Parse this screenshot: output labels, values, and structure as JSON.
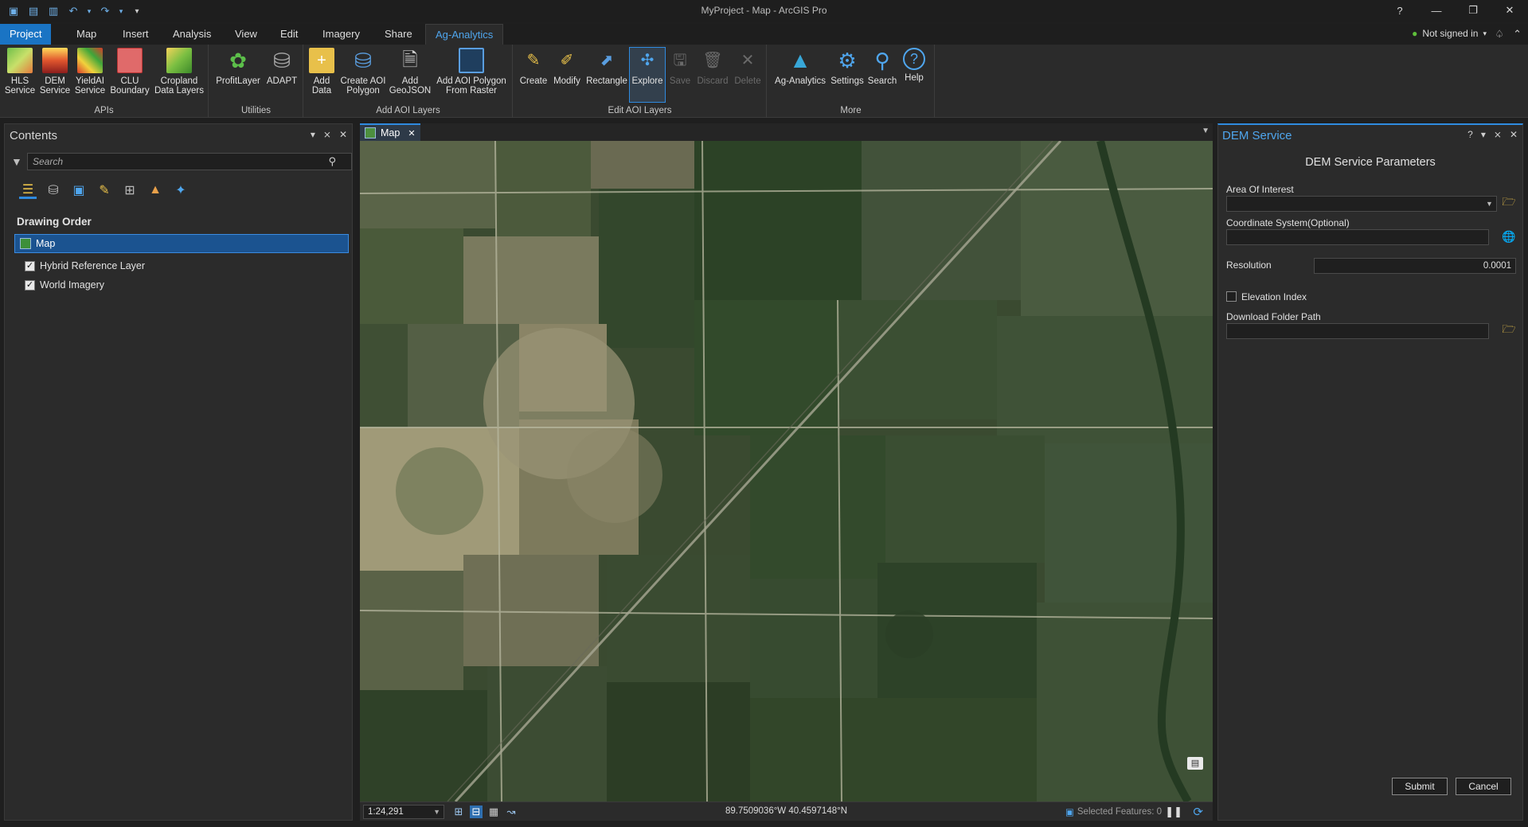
{
  "window": {
    "title": "MyProject - Map - ArcGIS Pro",
    "help": "?",
    "minimize": "—",
    "restore": "❐",
    "close": "✕"
  },
  "qat": {
    "icons": [
      "▣",
      "▤",
      "▥",
      "↶",
      "▾",
      "↷",
      "▾",
      "▾"
    ]
  },
  "tabs": [
    "Project",
    "Map",
    "Insert",
    "Analysis",
    "View",
    "Edit",
    "Imagery",
    "Share",
    "Ag-Analytics"
  ],
  "signin": {
    "label": "Not signed in",
    "arrow": "▾"
  },
  "ribbon": {
    "groups": {
      "apis": "APIs",
      "utilities": "Utilities",
      "add_aoi": "Add AOI Layers",
      "edit_aoi": "Edit AOI Layers",
      "more": "More"
    },
    "apis": [
      {
        "l1": "HLS",
        "l2": "Service"
      },
      {
        "l1": "DEM",
        "l2": "Service"
      },
      {
        "l1": "YieldAI",
        "l2": "Service"
      },
      {
        "l1": "CLU",
        "l2": "Boundary"
      },
      {
        "l1": "Cropland",
        "l2": "Data Layers"
      }
    ],
    "utilities": [
      {
        "l1": "ProfitLayer",
        "l2": ""
      },
      {
        "l1": "ADAPT",
        "l2": ""
      }
    ],
    "add_aoi": [
      {
        "l1": "Add",
        "l2": "Data"
      },
      {
        "l1": "Create AOI",
        "l2": "Polygon"
      },
      {
        "l1": "Add",
        "l2": "GeoJSON"
      },
      {
        "l1": "Add AOI Polygon",
        "l2": "From Raster"
      }
    ],
    "edit_aoi": [
      {
        "l1": "Create",
        "l2": ""
      },
      {
        "l1": "Modify",
        "l2": ""
      },
      {
        "l1": "Rectangle",
        "l2": ""
      },
      {
        "l1": "Explore",
        "l2": ""
      },
      {
        "l1": "Save",
        "l2": ""
      },
      {
        "l1": "Discard",
        "l2": ""
      },
      {
        "l1": "Delete",
        "l2": ""
      }
    ],
    "more": [
      {
        "l1": "Ag-Analytics",
        "l2": ""
      },
      {
        "l1": "Settings",
        "l2": ""
      },
      {
        "l1": "Search",
        "l2": ""
      },
      {
        "l1": "Help",
        "l2": ""
      }
    ]
  },
  "contents": {
    "title": "Contents",
    "search_placeholder": "Search",
    "section": "Drawing Order",
    "map_label": "Map",
    "layers": [
      "Hybrid Reference Layer",
      "World Imagery"
    ]
  },
  "mapview": {
    "tab": "Map",
    "scale": "1:24,291",
    "coords": "89.7509036°W 40.4597148°N",
    "selected_features": "Selected Features: 0"
  },
  "dem": {
    "title": "DEM Service",
    "subtitle": "DEM Service Parameters",
    "aoi_label": "Area Of Interest",
    "aoi_value": "",
    "cs_label": "Coordinate System(Optional)",
    "cs_value": "",
    "res_label": "Resolution",
    "res_value": "0.0001",
    "elev_label": "Elevation Index",
    "dl_label": "Download Folder Path",
    "dl_value": "",
    "submit": "Submit",
    "cancel": "Cancel"
  },
  "colors": {
    "accent": "#2f8be0",
    "project_tab": "#1a74c4",
    "selected_row": "#1b5390"
  }
}
